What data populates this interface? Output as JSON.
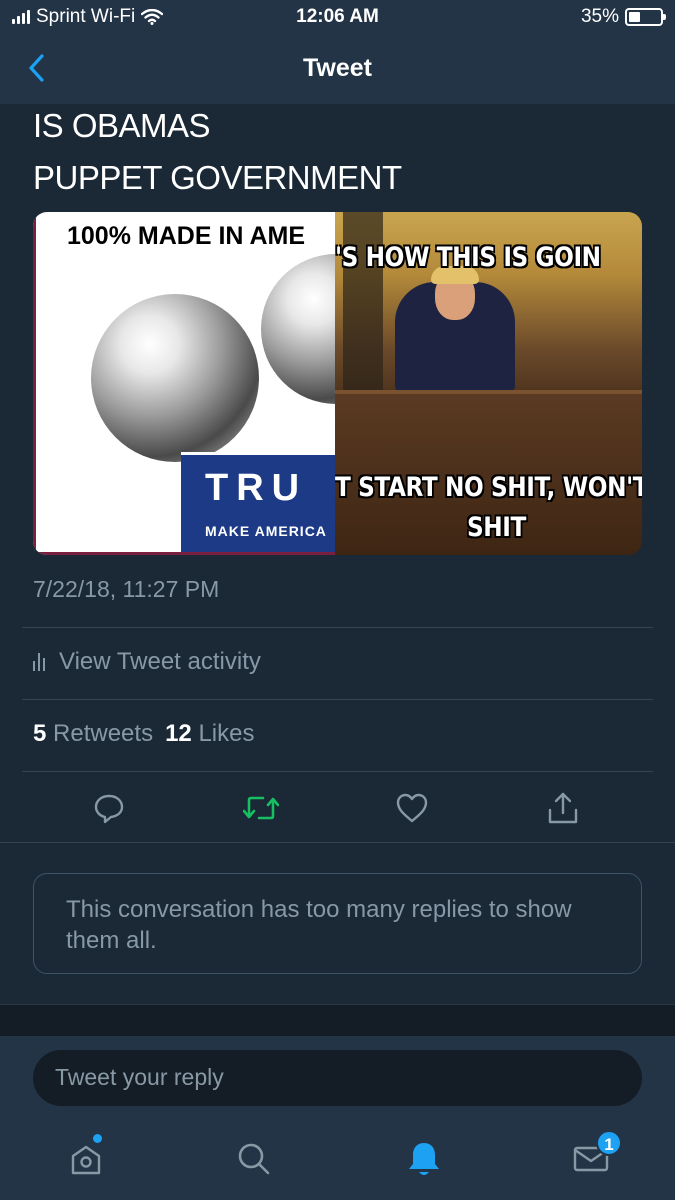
{
  "status_bar": {
    "carrier": "Sprint Wi-Fi",
    "time": "12:06 AM",
    "battery": "35%",
    "battery_level": 0.35
  },
  "header": {
    "title": "Tweet",
    "back_icon": "chevron-left-icon"
  },
  "tweet": {
    "lines": [
      "IS OBAMAS",
      "PUPPET GOVERNMENT"
    ],
    "media": {
      "left_headline": "100% MADE IN AME",
      "left_banner_big": "TRU",
      "left_banner_small": "MAKE AMERICA",
      "right_top": "'S HOW THIS IS GOIN",
      "right_bottom_line1": "T START NO SHIT, WON'T",
      "right_bottom_line2": "SHIT"
    },
    "timestamp": "7/22/18, 11:27 PM",
    "activity_label": "View Tweet activity",
    "retweets_count": "5",
    "retweets_label": "Retweets",
    "likes_count": "12",
    "likes_label": "Likes"
  },
  "actions": [
    {
      "name": "reply-icon",
      "color": "#8899a6"
    },
    {
      "name": "retweet-icon",
      "color": "#17bf63"
    },
    {
      "name": "like-icon",
      "color": "#8899a6"
    },
    {
      "name": "share-icon",
      "color": "#8899a6"
    }
  ],
  "notice": "This conversation has too many replies to show them all.",
  "reply": {
    "placeholder": "Tweet your reply"
  },
  "tabbar": {
    "items": [
      {
        "name": "home-icon",
        "indicator": "dot"
      },
      {
        "name": "search-icon"
      },
      {
        "name": "notifications-icon",
        "active": true
      },
      {
        "name": "messages-icon",
        "badge": "1"
      }
    ]
  },
  "colors": {
    "background": "#1b2836",
    "header": "#243447",
    "accent": "#1da1f2",
    "secondary_text": "#8899a6",
    "retweet_green": "#17bf63"
  }
}
